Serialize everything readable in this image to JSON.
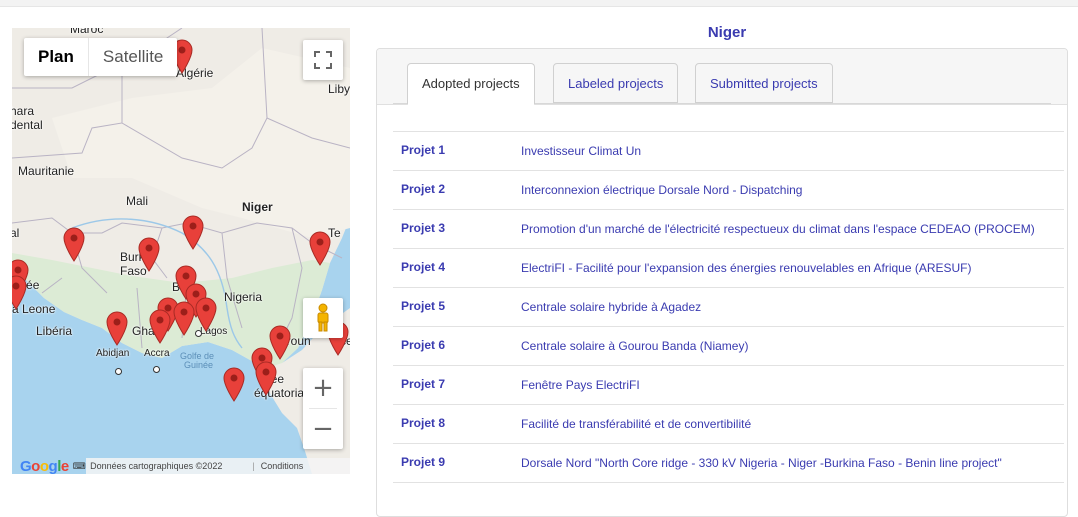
{
  "country": "Niger",
  "map": {
    "map_type_options": [
      "Plan",
      "Satellite"
    ],
    "map_type_selected": "Plan",
    "labels": {
      "maroc": "Maroc",
      "algerie": "Algérie",
      "libye": "Liby",
      "sahara": "hara",
      "occidental": "dental",
      "mauritanie": "Mauritanie",
      "mali": "Mali",
      "niger": "Niger",
      "burkina1": "Burk",
      "burkina2": "Faso",
      "benin": "Bn",
      "nigeria": "Nigeria",
      "guinee1": "au",
      "guinee2": "uinée",
      "sierra": "ra Leone",
      "liberia": "Libéria",
      "ghana": "Gha",
      "lagos": "Lagos",
      "abidjan": "Abidjan",
      "accra": "Accra",
      "golfe1": "Golfe de",
      "golfe2": "Guinée",
      "cameroun": "eroun",
      "ce": "ce",
      "guinee_eq1": "née",
      "guinee_eq2": "équatoriale",
      "tchad": "Te",
      "al": "al"
    },
    "zoom_in": "+",
    "zoom_out": "−",
    "google_logo": "Google",
    "attribution": "Données cartographiques ©2022 Google",
    "terms": "Conditions d'utilisation",
    "marker_color": "#e8403a",
    "pegman_color": "#f4b400"
  },
  "tabs": [
    "Adopted projects",
    "Labeled projects",
    "Submitted projects"
  ],
  "active_tab": 0,
  "projects": [
    {
      "id": "Projet 1",
      "name": "Investisseur Climat Un"
    },
    {
      "id": "Projet 2",
      "name": "Interconnexion électrique Dorsale Nord - Dispatching"
    },
    {
      "id": "Projet 3",
      "name": "Promotion d'un marché de l'électricité respectueux du climat dans l'espace CEDEAO (PROCEM)"
    },
    {
      "id": "Projet 4",
      "name": "ElectriFI - Facilité pour l'expansion des énergies renouvelables en Afrique (ARESUF)"
    },
    {
      "id": "Projet 5",
      "name": "Centrale solaire hybride à Agadez"
    },
    {
      "id": "Projet 6",
      "name": "Centrale solaire à Gourou Banda (Niamey)"
    },
    {
      "id": "Projet 7",
      "name": "Fenêtre Pays ElectriFI"
    },
    {
      "id": "Projet 8",
      "name": "Facilité de transférabilité et de convertibilité"
    },
    {
      "id": "Projet 9",
      "name": "Dorsale Nord \"North Core ridge - 330 kV Nigeria - Niger -Burkina Faso - Benin line project\""
    }
  ],
  "colors": {
    "accent": "#3a3bb0",
    "land": "#efece6",
    "water": "#a8d3ee"
  }
}
